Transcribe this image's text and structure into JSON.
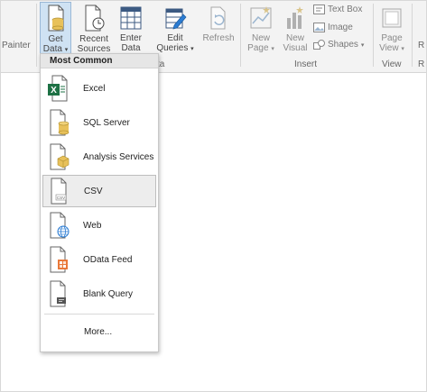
{
  "ribbon": {
    "painter_label": "Painter",
    "buttons": {
      "get_data": {
        "line1": "Get",
        "line2": "Data"
      },
      "recent_sources": {
        "line1": "Recent",
        "line2": "Sources"
      },
      "enter_data": {
        "line1": "Enter",
        "line2": "Data"
      },
      "edit_queries": {
        "line1": "Edit",
        "line2": "Queries"
      },
      "refresh": {
        "line1": "Refresh"
      },
      "new_page": {
        "line1": "New",
        "line2": "Page"
      },
      "new_visual": {
        "line1": "New",
        "line2": "Visual"
      },
      "page_view": {
        "line1": "Page",
        "line2": "View"
      }
    },
    "small_buttons": {
      "text_box": "Text Box",
      "image": "Image",
      "shapes": "Shapes"
    },
    "group_labels": {
      "data_partial": "ta",
      "insert": "Insert",
      "view": "View"
    }
  },
  "dropdown": {
    "header": "Most Common",
    "items": [
      {
        "label": "Excel",
        "icon": "excel-file-icon"
      },
      {
        "label": "SQL Server",
        "icon": "sql-server-database-icon"
      },
      {
        "label": "Analysis Services",
        "icon": "analysis-services-cube-icon"
      },
      {
        "label": "CSV",
        "icon": "csv-file-icon"
      },
      {
        "label": "Web",
        "icon": "web-globe-icon"
      },
      {
        "label": "OData Feed",
        "icon": "odata-feed-icon"
      },
      {
        "label": "Blank Query",
        "icon": "blank-query-icon"
      }
    ],
    "more": "More..."
  },
  "colors": {
    "excel_green": "#1e7145",
    "sql_yellow": "#e8c15a",
    "odata_orange": "#e9793a",
    "web_blue": "#2b7cd3",
    "pressed_blue": "#cfe2f3"
  }
}
